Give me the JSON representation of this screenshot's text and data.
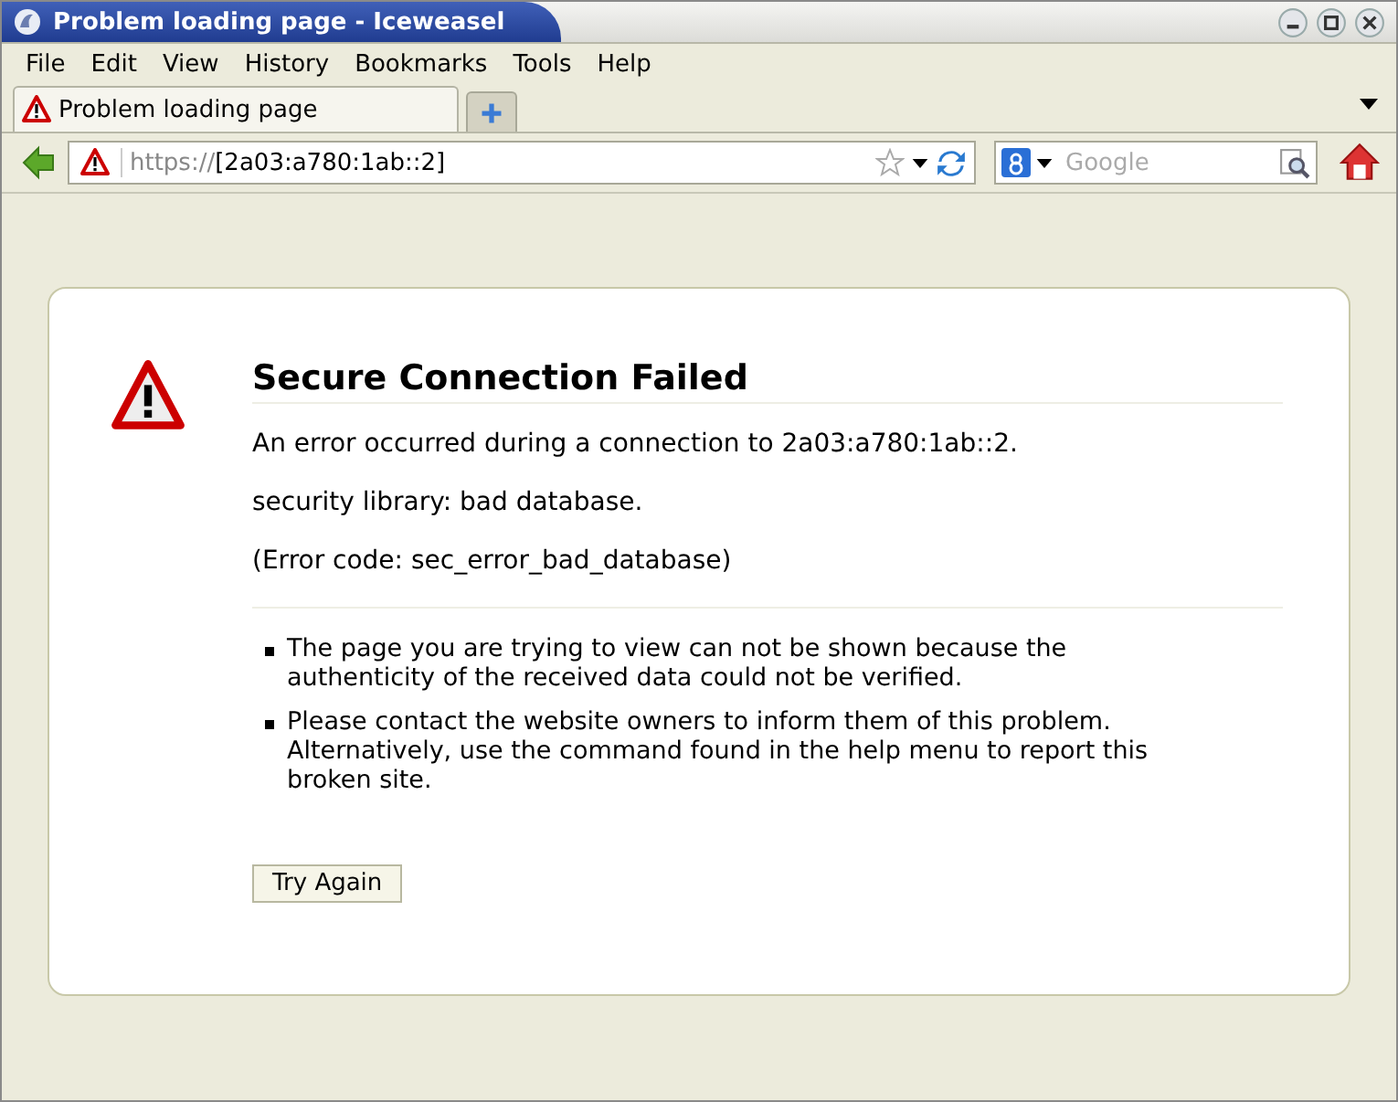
{
  "window": {
    "title": "Problem loading page - Iceweasel"
  },
  "menu": [
    "File",
    "Edit",
    "View",
    "History",
    "Bookmarks",
    "Tools",
    "Help"
  ],
  "tabs": [
    {
      "label": "Problem loading page",
      "selected": true
    }
  ],
  "url": {
    "scheme": "https://",
    "host": "[2a03:a780:1ab::2]"
  },
  "search": {
    "placeholder": "Google"
  },
  "error": {
    "title": "Secure Connection Failed",
    "paragraphs": [
      "An error occurred during a connection to 2a03:a780:1ab::2.",
      "security library: bad database.",
      "(Error code: sec_error_bad_database)"
    ],
    "bullets": [
      "The page you are trying to view can not be shown because the authenticity of the received data could not be verified.",
      "Please contact the website owners to inform them of this problem. Alternatively, use the command found in the help menu to report this broken site."
    ],
    "button": "Try Again"
  }
}
